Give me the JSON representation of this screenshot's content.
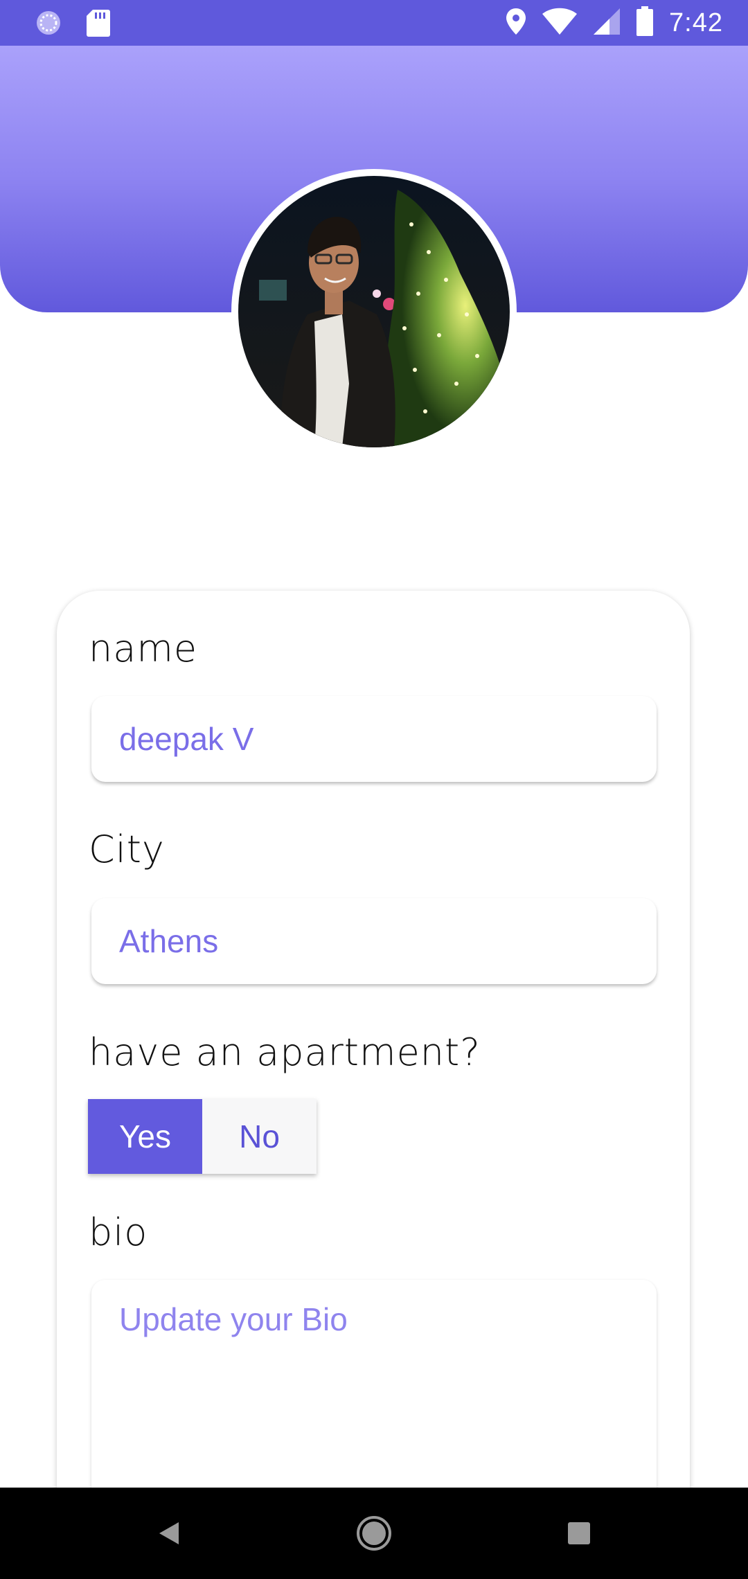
{
  "status_bar": {
    "time": "7:42",
    "left_icons": [
      "sync-icon",
      "sd-card-icon"
    ],
    "right_icons": [
      "location-icon",
      "wifi-icon",
      "signal-icon",
      "battery-icon"
    ]
  },
  "colors": {
    "accent": "#625ade",
    "header_top": "#aaa1fb",
    "header_bottom": "#6159dc",
    "input_text": "#7a6ee8"
  },
  "profile": {
    "avatar_alt": "profile-photo"
  },
  "form": {
    "name": {
      "label": "name",
      "value": "deepak V"
    },
    "city": {
      "label": "City",
      "value": "Athens"
    },
    "apartment": {
      "label": "have an apartment?",
      "options": [
        "Yes",
        "No"
      ],
      "selected": "Yes"
    },
    "bio": {
      "label": "bio",
      "placeholder": "Update your Bio"
    }
  },
  "nav_bar": {
    "buttons": [
      "back-icon",
      "home-icon",
      "recents-icon"
    ]
  }
}
